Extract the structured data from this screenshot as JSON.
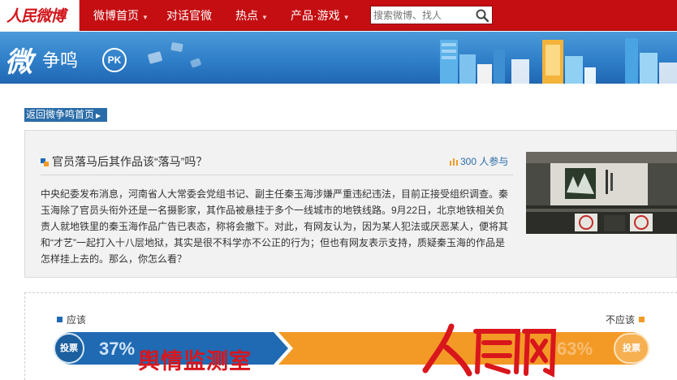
{
  "brand": {
    "logo_text": "人民微博"
  },
  "nav": {
    "items": [
      {
        "label": "微博首页",
        "has_menu": true
      },
      {
        "label": "对话官微",
        "has_menu": false
      },
      {
        "label": "热点",
        "has_menu": true
      },
      {
        "label": "产品·游戏",
        "has_menu": true
      }
    ],
    "search_placeholder": "搜索微博、找人",
    "search_icon": "magnifier-icon"
  },
  "banner": {
    "title_char": "微",
    "subtitle": "争鸣",
    "badge": "PK"
  },
  "back_link": "返回微争鸣首页",
  "topic": {
    "title": "官员落马后其作品该“落马”吗？",
    "participants_count": "300",
    "participants_label": "人参与",
    "body": "中央纪委发布消息，河南省人大常委会党组书记、副主任秦玉海涉嫌严重违纪违法，目前正接受组织调查。秦玉海除了官员头衔外还是一名摄影家，其作品被悬挂于多个一线城市的地铁线路。9月22日，北京地铁相关负责人就地铁里的秦玉海作品广告已表态，称将会撤下。对此，有网友认为，因为某人犯法或厌恶某人，便将其和“才艺”一起打入十八层地狱，其实是很不科学亦不公正的行为；但也有网友表示支持，质疑秦玉海的作品是怎样挂上去的。那么，你怎么看？"
  },
  "vote": {
    "yes_label": "应该",
    "no_label": "不应该",
    "yes_percent": "37%",
    "no_percent": "63%",
    "yes_share": 0.37,
    "vote_button": "投票",
    "yes_color": "#1f6ab3",
    "no_color": "#f39a26"
  },
  "watermark": {
    "logo": "人民网",
    "text": "舆情监测室"
  }
}
